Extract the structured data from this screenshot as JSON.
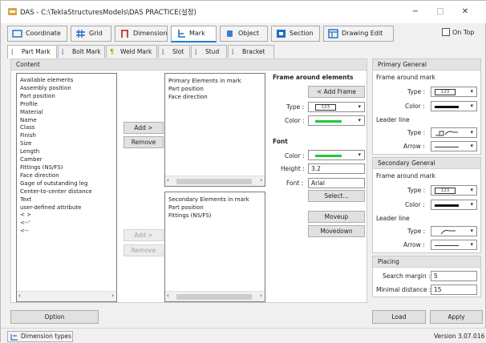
{
  "window": {
    "title": "DAS - C:\\TeklaStructuresModels\\DAS PRACTICE(설정)",
    "minimize_glyph": "−",
    "maximize_glyph": "□",
    "close_glyph": "✕"
  },
  "main_tabs": [
    {
      "label": "Coordinate",
      "icon": "coordinate-icon"
    },
    {
      "label": "Grid",
      "icon": "grid-icon"
    },
    {
      "label": "Dimension",
      "icon": "dimension-icon"
    },
    {
      "label": "Mark",
      "icon": "mark-icon"
    },
    {
      "label": "Object",
      "icon": "object-icon"
    },
    {
      "label": "Section",
      "icon": "section-icon"
    },
    {
      "label": "Drawing Edit",
      "icon": "drawing-edit-icon"
    }
  ],
  "on_top": {
    "label": "On Top",
    "checked": false
  },
  "sub_tabs": [
    {
      "label": "Part Mark"
    },
    {
      "label": "Bolt Mark"
    },
    {
      "label": "Weld Mark"
    },
    {
      "label": "Slot"
    },
    {
      "label": "Stud"
    },
    {
      "label": "Bracket"
    }
  ],
  "content": {
    "header": "Content",
    "available_items": [
      "Available elements",
      "Assembly position",
      "Part position",
      "Profile",
      "Material",
      "Name",
      "Class",
      "Finish",
      "Size",
      "Length",
      "Camber",
      "Fittings (NS/FS)",
      "Face direction",
      "Gage of outstanding leg",
      "Center-to-center distance",
      "Text",
      "user-defined attribute",
      "< >",
      "<--'",
      "<--"
    ],
    "primary_items": [
      "Primary Elements in mark",
      "Part position",
      "Face direction"
    ],
    "secondary_items": [
      "Secondary Elements in mark",
      "Part position",
      "Fittings (NS/FS)"
    ],
    "add_label": "Add >",
    "remove_label": "Remove",
    "frame_title": "Frame around elements",
    "add_frame_label": "< Add Frame",
    "type_label": "Type :",
    "color_label": "Color :",
    "font_title": "Font",
    "height_label": "Height :",
    "height_value": "3.2",
    "font_label": "Font :",
    "font_value": "Arial",
    "select_label": "Select...",
    "moveup_label": "Moveup",
    "movedown_label": "Movedown",
    "type_symbol": "123",
    "green": "#22c933"
  },
  "primary_general": {
    "header": "Primary General",
    "frame_label": "Frame around mark",
    "type_label": "Type :",
    "type_symbol": "123",
    "color_label": "Color :",
    "leader_label": "Leader line",
    "leader_type_label": "Type :",
    "arrow_label": "Arrow :"
  },
  "secondary_general": {
    "header": "Secondary General",
    "frame_label": "Frame around mark",
    "type_label": "Type :",
    "type_symbol": "123",
    "color_label": "Color :",
    "leader_label": "Leader line",
    "leader_type_label": "Type :",
    "arrow_label": "Arrow :"
  },
  "placing": {
    "header": "Placing",
    "search_margin_label": "Search margin :",
    "search_margin_value": "5",
    "minimal_distance_label": "Minimal distance :",
    "minimal_distance_value": "15"
  },
  "buttons": {
    "option": "Option",
    "load": "Load",
    "apply": "Apply"
  },
  "status": {
    "dimension_types": "Dimension types",
    "version": "Version 3.07.016"
  }
}
